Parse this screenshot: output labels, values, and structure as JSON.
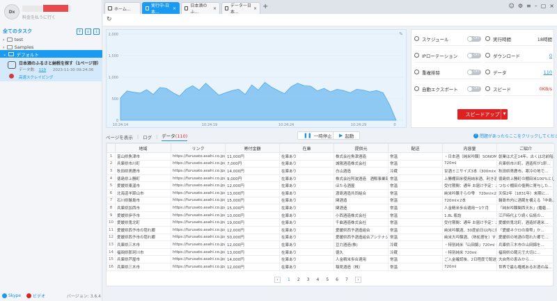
{
  "sidebar": {
    "logo_text": "Dx",
    "user_sub": "料金を払うに行く",
    "task_header_title": "全てのタスク",
    "tree": {
      "test": "test",
      "samples": "Samples",
      "default": "デフォルト"
    },
    "task": {
      "title": "日本酒のふるさと納税を探す（1ページ目）",
      "data_label": "データ数",
      "data_count": "110",
      "date": "2023-11-30 09:24:36",
      "status": "高速スクレイピング"
    },
    "footer": {
      "skype": "Skype",
      "video": "ビデオ",
      "version": "バージョン: 3.6.4"
    }
  },
  "tabs": [
    {
      "label": "ホーム..."
    },
    {
      "label": "実行中-日本..."
    },
    {
      "label": "日本酒のふ..."
    },
    {
      "label": "データー日本..."
    }
  ],
  "chart_data": {
    "type": "area",
    "x_ticks": [
      "10:24:14",
      "10:24:19",
      "10:24:24",
      "10:24:29"
    ],
    "x_last_tick": "0",
    "y_ticks": [
      0,
      500,
      1000,
      1500,
      2000
    ],
    "y_tick_labels": [
      "0",
      "500",
      "1,000",
      "1,500",
      "2,000"
    ],
    "ylim": [
      0,
      2000
    ],
    "values": [
      520,
      680,
      650,
      630,
      710,
      600,
      760,
      740,
      640,
      560,
      720,
      800,
      700,
      860,
      720,
      580,
      640,
      690,
      720,
      600,
      820,
      700,
      880,
      770,
      690,
      620,
      780,
      860,
      800,
      790,
      680,
      740,
      660,
      720,
      690,
      640,
      720,
      700,
      660,
      690,
      640,
      360,
      0
    ],
    "color": "#7cc1f0"
  },
  "stats": {
    "schedule": {
      "label": "スケジュール",
      "toggle": "OFF"
    },
    "runtime": {
      "label": "実行時間",
      "value": "18時間"
    },
    "ip_rotation": {
      "label": "IPローテーション",
      "toggle": "OFF"
    },
    "download": {
      "label": "ダウンロード",
      "value": "0"
    },
    "dedupe": {
      "label": "重複排除",
      "toggle": "OFF"
    },
    "data": {
      "label": "データ",
      "value": "110"
    },
    "auto_export": {
      "label": "自動エクスポート",
      "toggle": "OFF"
    },
    "speed": {
      "label": "スピード",
      "value": "0KB/s"
    },
    "speedup_button": "スピードアップ"
  },
  "view_tabs": {
    "page": "ページを表示",
    "log": "ログ",
    "data": "データ",
    "data_count": "(110)"
  },
  "buttons": {
    "pause": "一時停止",
    "start": "起動"
  },
  "help_text": "問題があったらここをクリックしてください",
  "grid": {
    "columns": [
      "",
      "地域",
      "リンク",
      "寄付金額",
      "在庫",
      "提供元",
      "配送",
      "内容量",
      "ご紹介"
    ],
    "rows": [
      [
        "1",
        "富山県魚津市",
        "https://furusato.asahi.co.jp/good...",
        "11,000円",
        "在庫あり",
        "株式会社魚津酒造",
        "常温",
        "・日本酒（純米吟醸）SONOMAM...",
        "創業は大正14年。古くは北前船..."
      ],
      [
        "2",
        "兵庫県市川町",
        "https://furusato.asahi.co.jp/good...",
        "7,000円",
        "在庫あり",
        "城陽酒造株式会社",
        "常温",
        "720ml",
        "兵庫県市川町。酒造所が1軒..."
      ],
      [
        "3",
        "秋田県男鹿市",
        "https://furusato.asahi.co.jp/good...",
        "14,000円",
        "在庫あり",
        "白山酒造",
        "冷蔵",
        "甘酒ミニサイズ3本（300ml×3...",
        "秋田県男鹿市。寒冷の地で..."
      ],
      [
        "4",
        "徳島県上勝町",
        "https://furusato.asahi.co.jp/good...",
        "9,000円",
        "在庫あり",
        "株式会社阿波酒造　酒販事業部",
        "常温",
        "上勝棚田米使用純米酒、利き酒...",
        "徳島県上勝町の棚田米100%とした..."
      ],
      [
        "5",
        "愛媛県東温市",
        "https://furusato.asahi.co.jp/good...",
        "12,000円",
        "在庫あり",
        "ほたる酒屋",
        "常温",
        "受付期間：通年 お届け予定：ご...",
        "つなぐ棚田の復興に寄与した..."
      ],
      [
        "6",
        "北海道羊蹄山市",
        "https://furusato.asahi.co.jp/good...",
        "13,000円",
        "在庫あり",
        "渡島酒造共同組合",
        "常温",
        "純米吟醸そらの雫　720ml×2本",
        "天保2年（1831年）末期に..."
      ],
      [
        "7",
        "石川県輪島市",
        "https://furusato.asahi.co.jp/good...",
        "15,000円",
        "在庫あり",
        "関酒造",
        "常温",
        "720ml×2本",
        "輪島市内に酒蔵を構える「中島..."
      ],
      [
        "8",
        "兵庫県加西市",
        "https://furusato.asahi.co.jp/good...",
        "15,000円",
        "在庫あり",
        "関酒造",
        "常温",
        "人金精米歩合適用一1ケ月",
        "「純米吟醸関西天水」(播磨..."
      ],
      [
        "9",
        "愛媛県伊予市",
        "https://furusato.asahi.co.jp/good...",
        "10,000円",
        "在庫あり",
        "小西酒造株式会社",
        "常温",
        "1.8L 瓶詰",
        "江戸時代より続く伝統の..."
      ],
      [
        "10",
        "愛媛県鬼北町",
        "https://furusato.asahi.co.jp/good...",
        "19,000円",
        "在庫あり",
        "千曲酒造株式会社",
        "常温",
        "受付期間：通年 お届け予定：ご...",
        "愛媛県鬼北町。酒造好適米..."
      ],
      [
        "11",
        "愛媛県西予市の隠れ郷",
        "https://furusato.asahi.co.jp/good...",
        "12,000円",
        "在庫あり",
        "愛媛県西予酒造組合",
        "常温",
        "純米吟醸酒、30度前日以内に発...",
        "「愛媛ネクロの扉雫」か..."
      ],
      [
        "12",
        "愛媛県西予市の隠れ郷",
        "https://furusato.asahi.co.jp/good...",
        "50,000円",
        "在庫あり",
        "愛媛県西予酒造組合アンテナショ...",
        "常温",
        "純米大吟醸酒、（熱処理を）する...",
        "愛媛県の地酒の隠れた郷で..."
      ],
      [
        "13",
        "兵庫県三木市",
        "https://furusato.asahi.co.jp/good...",
        "12,000円",
        "在庫あり",
        "豆力酒造(株)",
        "冷蔵",
        "・特別純米「山田錦」720ml・...",
        "兵庫県三木市の山田錦を..."
      ],
      [
        "14",
        "福岡県那珂川市",
        "https://furusato.asahi.co.jp/good...",
        "13,000円",
        "在庫あり",
        "徳久",
        "冷蔵",
        "・特別純米 720ml",
        "福岡県の蔵元で大切に..."
      ],
      [
        "15",
        "兵庫県芦屋市",
        "https://furusato.asahi.co.jp/good...",
        "14,000円",
        "在庫あり",
        "人金精米歩合適用",
        "常温",
        "ご入金確認後、2日程度で配送",
        "大自然の恵みから..."
      ],
      [
        "16",
        "兵庫県三木市",
        "https://furusato.asahi.co.jp/good...",
        "12,000円",
        "在庫あり",
        "稲見酒造（株）",
        "常温",
        "720ml",
        "世界で最も権威あるお酒の品..."
      ]
    ]
  },
  "pagination": {
    "pages": [
      "1",
      "2",
      "3",
      "4",
      "5",
      "6",
      "7"
    ],
    "current": "1"
  },
  "colors": {
    "accent": "#1a9af0",
    "danger": "#e02020",
    "chart_fill": "#7cc1f0"
  }
}
